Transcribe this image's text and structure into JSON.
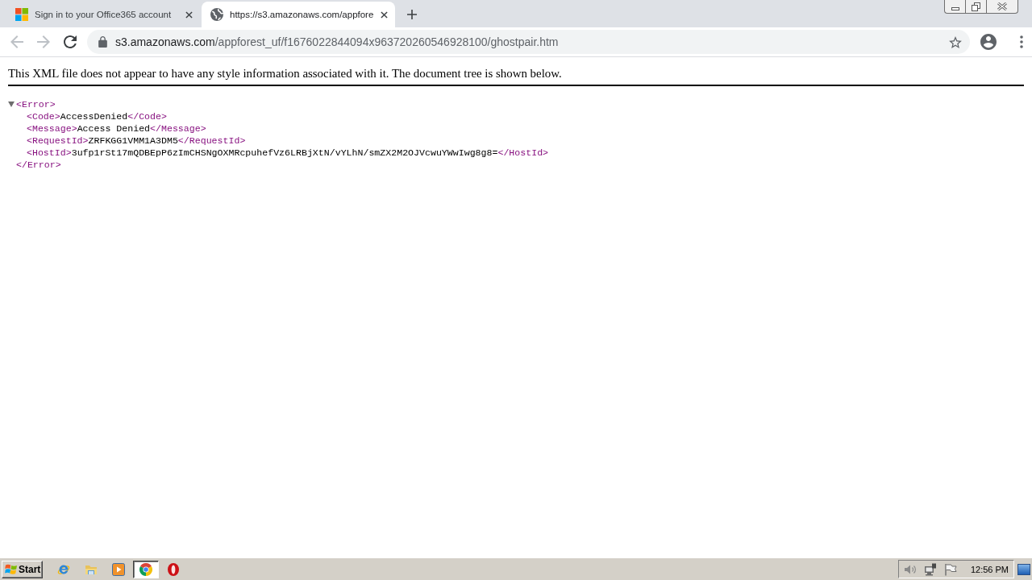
{
  "browser": {
    "tabs": [
      {
        "kind": "four-squares",
        "title": "Sign in to your Office365 account",
        "selected": false
      },
      {
        "kind": "globe",
        "title": "https://s3.amazonaws.com/appfore",
        "selected": true
      }
    ]
  },
  "toolbar": {
    "back": {
      "disabled": true
    },
    "forward": {
      "disabled": true
    },
    "address": {
      "host": "s3.amazonaws.com",
      "path": "/appforest_uf/f1676022844094x963720260546928100/ghostpair.htm"
    }
  },
  "page": {
    "notice": "This XML file does not appear to have any style information associated with it. The document tree is shown below.",
    "tree": {
      "open": "<Error>",
      "close": "</Error>",
      "expanded": true,
      "children": [
        {
          "open": "<Code>",
          "text": "AccessDenied",
          "close": "</Code>"
        },
        {
          "open": "<Message>",
          "text": "Access Denied",
          "close": "</Message>"
        },
        {
          "open": "<RequestId>",
          "text": "ZRFKGG1VMM1A3DM5",
          "close": "</RequestId>"
        },
        {
          "open": "<HostId>",
          "text": "3ufp1rSt17mQDBEpP6zImCHSNgOXMRcpuhefVz6LRBjXtN/vYLhN/smZX2M2OJVcwuYWwIwg8g8=",
          "close": "</HostId>"
        }
      ]
    }
  },
  "taskbar": {
    "start": "Start",
    "apps": [
      {
        "kind": "e-logo",
        "selected": false
      },
      {
        "kind": "folder",
        "selected": false
      },
      {
        "kind": "player",
        "selected": false
      },
      {
        "kind": "round-logo",
        "selected": true
      },
      {
        "kind": "o-logo",
        "selected": false
      }
    ],
    "tray": [
      {
        "kind": "speaker"
      },
      {
        "kind": "network"
      },
      {
        "kind": "flag"
      }
    ],
    "clock": "12:56 PM"
  }
}
